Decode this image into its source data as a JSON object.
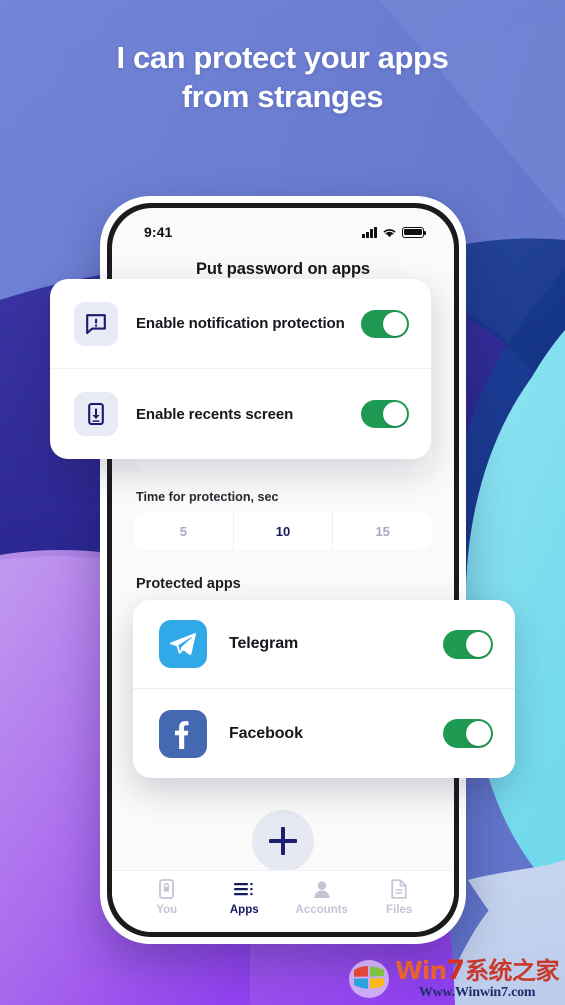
{
  "headline": {
    "line1": "I can protect your apps",
    "line2": "from stranges"
  },
  "colors": {
    "bg_top": "#6f80d2",
    "bg_indigo": "#2a2a8f",
    "bg_navy": "#1b3a8f",
    "bg_purple_light": "#b888e8",
    "bg_purple": "#9b4ff0",
    "bg_cyan": "#7fe0ef",
    "bg_lightblue": "#c3d2ee",
    "accent_navy": "#141a5e",
    "toggle_green": "#1f9a53",
    "telegram_blue": "#31a8e8",
    "facebook_blue": "#4568b2",
    "icon_tile": "#e8eaf6"
  },
  "phone": {
    "status_bar": {
      "time": "9:41",
      "icons": [
        "signal-icon",
        "wifi-icon",
        "battery-icon"
      ]
    },
    "screen_title": "Put password on apps",
    "settings_card": {
      "rows": [
        {
          "icon": "notification-alert-icon",
          "label": "Enable notification protection",
          "toggle": "on"
        },
        {
          "icon": "phone-download-icon",
          "label": "Enable recents screen",
          "toggle": "on"
        }
      ]
    },
    "time_section": {
      "label": "Time for protection, sec",
      "options": [
        "5",
        "10",
        "15"
      ],
      "selected": "10"
    },
    "protected_section": {
      "label": "Protected apps",
      "apps": [
        {
          "icon": "telegram-icon",
          "name": "Telegram",
          "toggle": "on"
        },
        {
          "icon": "facebook-icon",
          "name": "Facebook",
          "toggle": "on"
        }
      ]
    },
    "add_button": {
      "icon": "plus-icon",
      "label": "+"
    },
    "tabbar": {
      "items": [
        {
          "icon": "phone-lock-icon",
          "label": "You",
          "active": false
        },
        {
          "icon": "list-icon",
          "label": "Apps",
          "active": true
        },
        {
          "icon": "person-icon",
          "label": "Accounts",
          "active": false
        },
        {
          "icon": "document-icon",
          "label": "Files",
          "active": false
        }
      ]
    }
  },
  "watermark": {
    "brand_win": "Win",
    "brand_7": "7",
    "brand_cn": "系统之家",
    "url": "Www.Winwin7.com",
    "logo": "windows-logo-icon"
  }
}
